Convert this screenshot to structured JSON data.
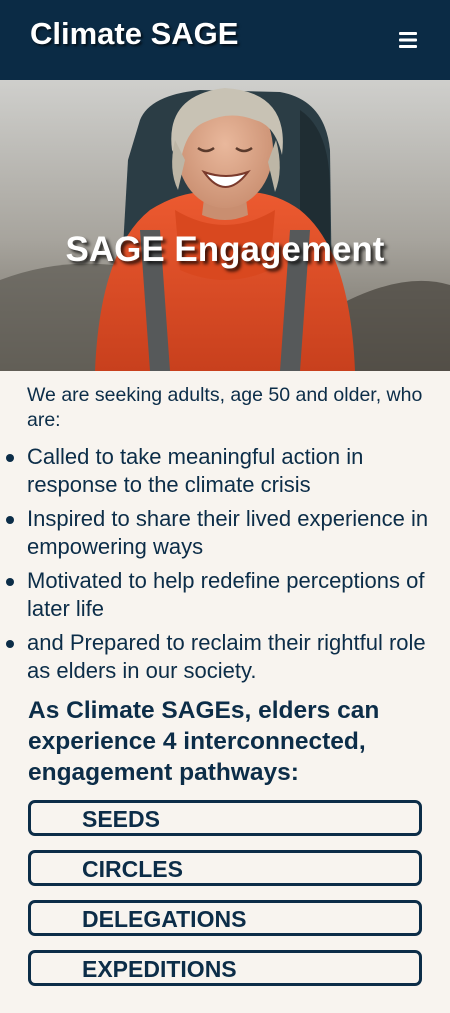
{
  "header": {
    "brand": "Climate SAGE",
    "menu_icon": "hamburger-menu-icon"
  },
  "hero": {
    "title": "SAGE Engagement"
  },
  "intro": {
    "text": "We are seeking adults, age 50 and older, who are:"
  },
  "qualities": [
    "Called to take meaningful action in response to the climate crisis",
    "Inspired to share their lived experience in empowering ways",
    "Motivated to help redefine perceptions of later life",
    "and Prepared to reclaim their rightful role as elders in our society."
  ],
  "pathways": {
    "heading": "As Climate SAGEs, elders can experience 4 interconnected, engagement pathways:",
    "items": [
      "SEEDS",
      "CIRCLES",
      "DELEGATIONS",
      "EXPEDITIONS"
    ]
  },
  "colors": {
    "navy": "#0b2b45",
    "text": "#0c2d48",
    "background": "#f8f4ef",
    "jacket": "#e0502a"
  }
}
